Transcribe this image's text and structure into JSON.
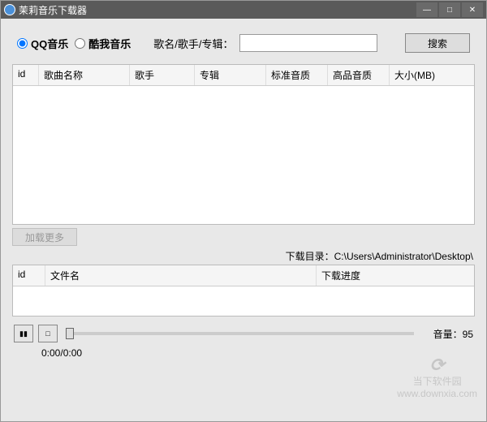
{
  "window": {
    "title": "茉莉音乐下载器"
  },
  "search": {
    "radio_qq": "QQ音乐",
    "radio_kuwo": "酷我音乐",
    "label": "歌名/歌手/专辑：",
    "value": "",
    "button": "搜索"
  },
  "results_table": {
    "headers": [
      "id",
      "歌曲名称",
      "歌手",
      "专辑",
      "标准音质",
      "高品音质",
      "大小(MB)"
    ]
  },
  "loadmore": "加载更多",
  "download_path_label": "下载目录：",
  "download_path": "C:\\Users\\Administrator\\Desktop\\",
  "downloads_table": {
    "headers": [
      "id",
      "文件名",
      "下载进度"
    ]
  },
  "player": {
    "time": "0:00/0:00",
    "volume_label": "音量：",
    "volume_value": "95"
  },
  "watermark": {
    "brand": "当下软件园",
    "url": "www.downxia.com"
  }
}
